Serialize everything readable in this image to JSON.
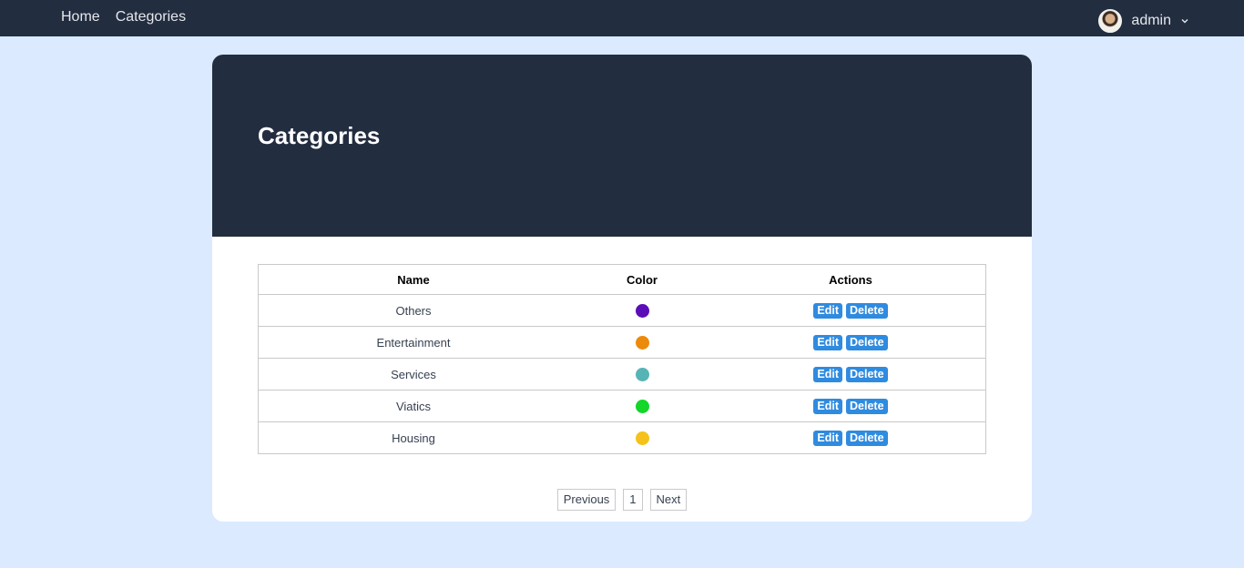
{
  "nav": {
    "links": [
      "Home",
      "Categories"
    ],
    "user": "admin"
  },
  "page": {
    "title": "Categories"
  },
  "table": {
    "headers": [
      "Name",
      "Color",
      "Actions"
    ],
    "rows": [
      {
        "name": "Others",
        "color": "#5b0eb8"
      },
      {
        "name": "Entertainment",
        "color": "#ec8a0c"
      },
      {
        "name": "Services",
        "color": "#56b4b6"
      },
      {
        "name": "Viatics",
        "color": "#12d62a"
      },
      {
        "name": "Housing",
        "color": "#f4c21a"
      }
    ],
    "edit_label": "Edit",
    "delete_label": "Delete"
  },
  "pagination": {
    "previous": "Previous",
    "current": "1",
    "next": "Next"
  }
}
